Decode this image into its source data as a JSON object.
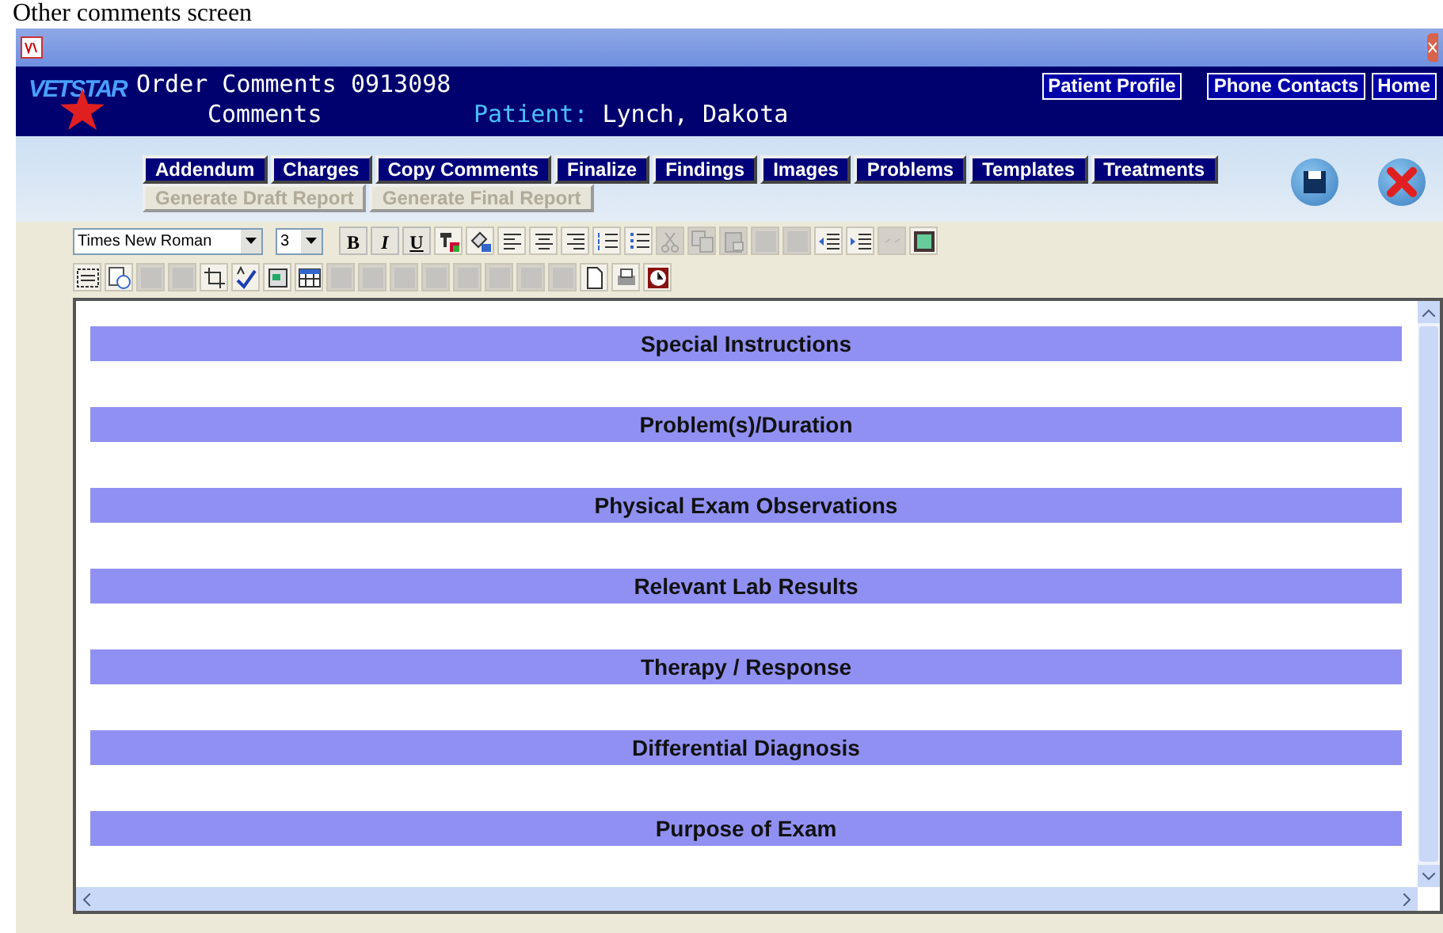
{
  "caption": "Other comments screen",
  "header": {
    "logo": "VETSTAR",
    "title": "Order Comments 0913098",
    "subtitle": "Comments",
    "patient_label": "Patient:",
    "patient_name": "Lynch, Dakota",
    "links": [
      "Patient Profile",
      "Phone Contacts",
      "Home"
    ]
  },
  "action_buttons": [
    {
      "label": "Addendum",
      "disabled": false
    },
    {
      "label": "Charges",
      "disabled": false
    },
    {
      "label": "Copy Comments",
      "disabled": false
    },
    {
      "label": "Finalize",
      "disabled": false
    },
    {
      "label": "Findings",
      "disabled": false
    },
    {
      "label": "Images",
      "disabled": false
    },
    {
      "label": "Problems",
      "disabled": false
    },
    {
      "label": "Templates",
      "disabled": false
    },
    {
      "label": "Treatments",
      "disabled": false
    }
  ],
  "report_buttons": [
    {
      "label": "Generate Draft Report",
      "disabled": true
    },
    {
      "label": "Generate Final Report",
      "disabled": true
    }
  ],
  "font_select": {
    "value": "Times New Roman"
  },
  "size_select": {
    "value": "3"
  },
  "format_buttons": [
    {
      "label": "B",
      "kind": "bold"
    },
    {
      "label": "I",
      "kind": "italic"
    },
    {
      "label": "U",
      "kind": "underline"
    }
  ],
  "toolbar_1": [
    {
      "kind": "text-color",
      "disabled": false
    },
    {
      "kind": "fill-color",
      "disabled": false
    },
    {
      "kind": "align-left",
      "disabled": false
    },
    {
      "kind": "align-center",
      "disabled": false
    },
    {
      "kind": "align-right",
      "disabled": false
    },
    {
      "kind": "numbered-list",
      "disabled": false
    },
    {
      "kind": "bullet-list",
      "disabled": false
    },
    {
      "kind": "cut",
      "disabled": true
    },
    {
      "kind": "copy",
      "disabled": true
    },
    {
      "kind": "paste",
      "disabled": true
    },
    {
      "kind": "undo",
      "disabled": true
    },
    {
      "kind": "redo",
      "disabled": true
    },
    {
      "kind": "outdent",
      "disabled": false
    },
    {
      "kind": "indent",
      "disabled": false
    },
    {
      "kind": "link",
      "disabled": true
    },
    {
      "kind": "image",
      "disabled": false
    }
  ],
  "toolbar_2": [
    {
      "kind": "select-all",
      "disabled": false
    },
    {
      "kind": "history",
      "disabled": false
    },
    {
      "kind": "box",
      "disabled": true
    },
    {
      "kind": "box",
      "disabled": true
    },
    {
      "kind": "crop",
      "disabled": false
    },
    {
      "kind": "spell",
      "disabled": false
    },
    {
      "kind": "form",
      "disabled": false
    },
    {
      "kind": "table",
      "disabled": false
    },
    {
      "kind": "box",
      "disabled": true
    },
    {
      "kind": "box",
      "disabled": true
    },
    {
      "kind": "box",
      "disabled": true
    },
    {
      "kind": "box",
      "disabled": true
    },
    {
      "kind": "box",
      "disabled": true
    },
    {
      "kind": "box",
      "disabled": true
    },
    {
      "kind": "box",
      "disabled": true
    },
    {
      "kind": "box",
      "disabled": true
    },
    {
      "kind": "page",
      "disabled": false
    },
    {
      "kind": "print",
      "disabled": false
    },
    {
      "kind": "alarm",
      "disabled": false
    }
  ],
  "sections": [
    "Special Instructions",
    "Problem(s)/Duration",
    "Physical Exam Observations",
    "Relevant Lab Results",
    "Therapy / Response",
    "Differential Diagnosis",
    "Purpose of Exam"
  ]
}
